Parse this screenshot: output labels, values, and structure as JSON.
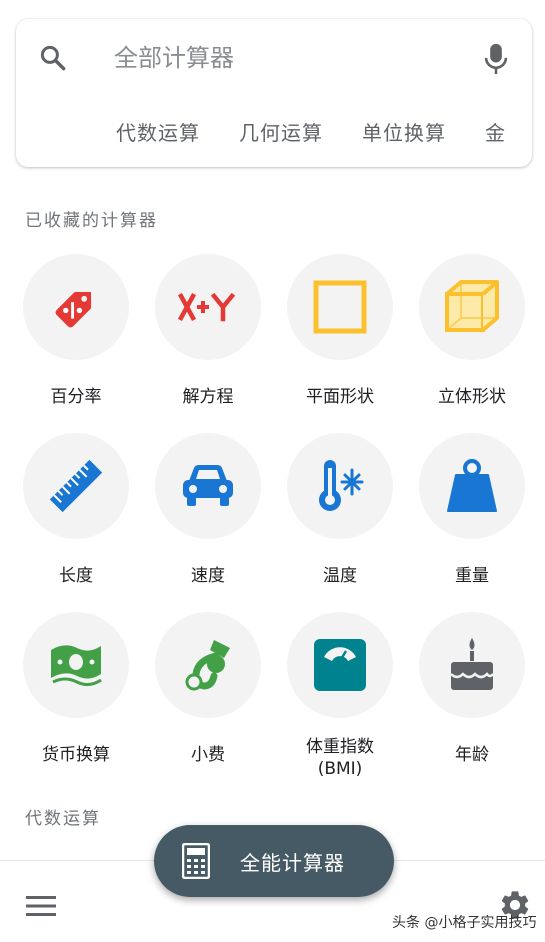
{
  "search": {
    "placeholder": "全部计算器",
    "chips": [
      "代数运算",
      "几何运算",
      "单位换算",
      "金"
    ]
  },
  "favorites": {
    "title": "已收藏的计算器",
    "items": [
      {
        "label": "百分率",
        "icon": "percentage-tag-icon",
        "color": "#e53935"
      },
      {
        "label": "解方程",
        "icon": "x-plus-y-icon",
        "color": "#e53935"
      },
      {
        "label": "平面形状",
        "icon": "square-icon",
        "color": "#fbc02d"
      },
      {
        "label": "立体形状",
        "icon": "cube-icon",
        "color": "#fbc02d"
      },
      {
        "label": "长度",
        "icon": "ruler-icon",
        "color": "#1976d2"
      },
      {
        "label": "速度",
        "icon": "car-icon",
        "color": "#1976d2"
      },
      {
        "label": "温度",
        "icon": "thermometer-icon",
        "color": "#1976d2"
      },
      {
        "label": "重量",
        "icon": "weight-icon",
        "color": "#1976d2"
      },
      {
        "label": "货币换算",
        "icon": "money-icon",
        "color": "#43a047"
      },
      {
        "label": "小费",
        "icon": "tip-hand-icon",
        "color": "#43a047"
      },
      {
        "label": "体重指数\n(BMI)",
        "icon": "scale-icon",
        "color": "#00838f"
      },
      {
        "label": "年龄",
        "icon": "cake-icon",
        "color": "#5f6368"
      }
    ]
  },
  "algebra_section": {
    "title": "代数运算"
  },
  "fab": {
    "label": "全能计算器"
  },
  "watermark": "头条 @小格子实用技巧"
}
